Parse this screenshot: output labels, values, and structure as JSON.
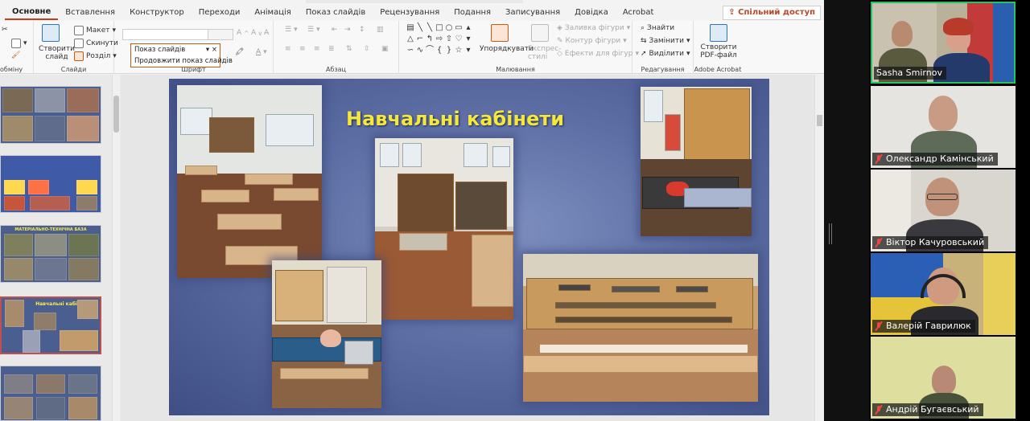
{
  "ribbon_tabs": [
    "Основне",
    "Вставлення",
    "Конструктор",
    "Переходи",
    "Анімація",
    "Показ слайдів",
    "Рецензування",
    "Подання",
    "Записування",
    "Довідка",
    "Acrobat"
  ],
  "active_tab": "Основне",
  "share_label": "Спільний доступ",
  "clipboard": {
    "label": "обміну"
  },
  "slides_group": {
    "new_slide": "Створити слайд",
    "layout": "Макет",
    "reset": "Скинути",
    "section": "Розділ",
    "label": "Слайди"
  },
  "font_group": {
    "label": "Шрифт"
  },
  "paragraph_group": {
    "label": "Абзац"
  },
  "drawing_group": {
    "arrange": "Упорядкувати",
    "quick_styles": "Експрес-стилі",
    "shape_fill": "Заливка фігури",
    "shape_outline": "Контур фігури",
    "shape_effects": "Ефекти для фігур",
    "label": "Малювання"
  },
  "editing_group": {
    "find": "Знайти",
    "replace": "Замінити",
    "select": "Виділити",
    "label": "Редагування"
  },
  "acrobat_group": {
    "create_pdf": "Створити PDF-файл",
    "label": "Adobe Acrobat"
  },
  "slideshow_popup": {
    "title": "Показ слайдів",
    "resume": "Продовжити показ слайдів"
  },
  "thumbnails": [
    {
      "title": ""
    },
    {
      "title": ""
    },
    {
      "title": "МАТЕРІАЛЬНО-ТЕХНІЧНА БАЗА"
    },
    {
      "title": "Навчальні кабінети"
    },
    {
      "title": ""
    }
  ],
  "slide": {
    "title": "Навчальні кабінети"
  },
  "participants": [
    {
      "name": "Sasha Smirnov",
      "muted": false,
      "active": true
    },
    {
      "name": "Олександр Камінський",
      "muted": true,
      "active": false
    },
    {
      "name": "Віктор Качуровський",
      "muted": true,
      "active": false
    },
    {
      "name": "Валерій Гаврилюк",
      "muted": true,
      "active": false
    },
    {
      "name": "Андрій Бугаєвський",
      "muted": true,
      "active": false
    }
  ]
}
